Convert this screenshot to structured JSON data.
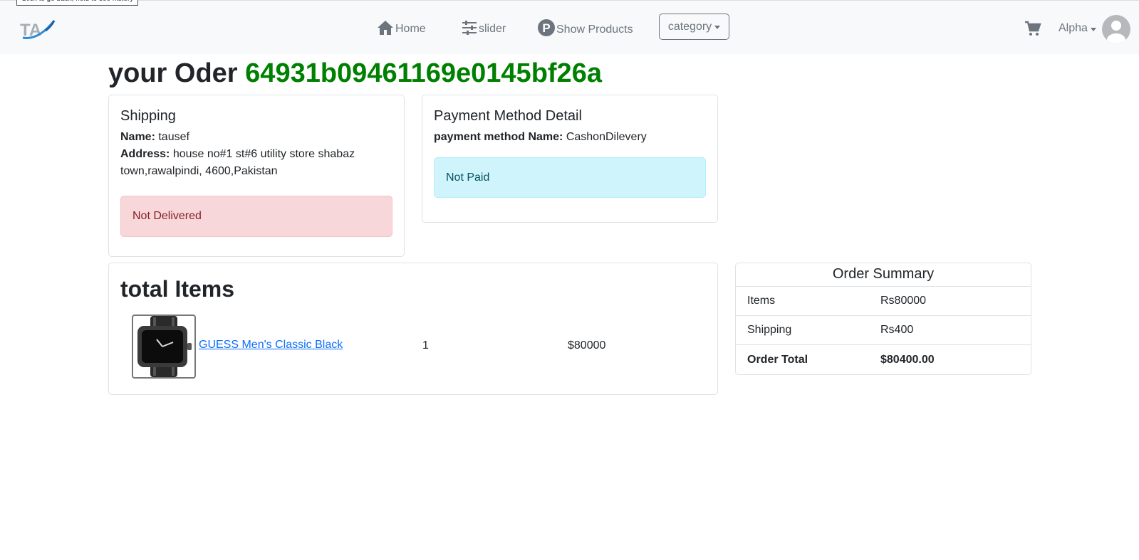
{
  "tooltip": "Click to go back, hold to see history",
  "nav": {
    "logo_text": "TA",
    "home": "Home",
    "slider": "slider",
    "products": "Show Products",
    "products_icon_letter": "P",
    "category": "category",
    "user": "Alpha"
  },
  "order": {
    "title_prefix": "your Oder",
    "id": "64931b09461169e0145bf26a"
  },
  "shipping": {
    "heading": "Shipping",
    "name_label": "Name:",
    "name": "tausef",
    "address_label": "Address:",
    "address": "house no#1 st#6 utility store shabaz town,rawalpindi, 4600,Pakistan",
    "status": "Not Delivered"
  },
  "payment": {
    "heading": "Payment Method Detail",
    "method_label": "payment method Name:",
    "method": "CashonDilevery",
    "status": "Not Paid"
  },
  "items": {
    "heading": "total Items",
    "list": [
      {
        "name": "GUESS Men's Classic Black",
        "qty": "1",
        "price": "$80000"
      }
    ]
  },
  "summary": {
    "heading": "Order Summary",
    "rows": [
      {
        "label": "Items",
        "value": "Rs80000"
      },
      {
        "label": "Shipping",
        "value": "Rs400"
      },
      {
        "label": "Order Total",
        "value": "$80400.00"
      }
    ]
  },
  "colors": {
    "order_id": "#008000",
    "link": "#0d6efd",
    "danger_bg": "#f8d7da",
    "info_bg": "#cff4fc",
    "navbar_bg": "#f8f9fa"
  }
}
